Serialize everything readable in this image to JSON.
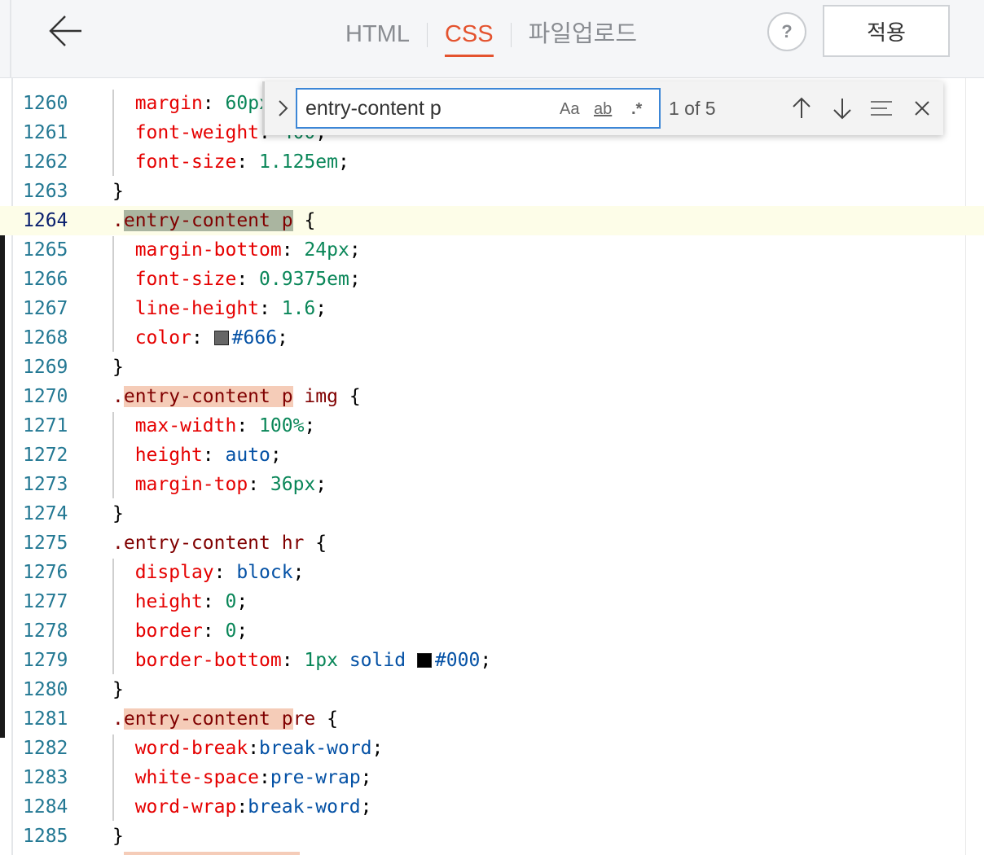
{
  "header": {
    "tabs": [
      {
        "label": "HTML",
        "active": false
      },
      {
        "label": "CSS",
        "active": true
      },
      {
        "label": "파일업로드",
        "active": false
      }
    ],
    "help_label": "?",
    "apply_label": "적용"
  },
  "find": {
    "query": "entry-content p",
    "match_case_label": "Aa",
    "whole_word_label": "ab",
    "regex_label": ".*",
    "match_count": "1 of 5"
  },
  "colors": {
    "accent": "#e4532f",
    "selector": "#800000",
    "property": "#e50000",
    "number": "#098658",
    "keyword": "#0451a5",
    "line_number": "#237893",
    "match_highlight": "#f5ccb8",
    "current_match": "#aab5a0",
    "current_line": "#fdfde8"
  },
  "code": {
    "current_line": 1264,
    "lines": [
      {
        "num": "1260",
        "text": "  margin: 60px 0 24px;"
      },
      {
        "num": "1261",
        "text": "  font-weight: 400;"
      },
      {
        "num": "1262",
        "text": "  font-size: 1.125em;"
      },
      {
        "num": "1263",
        "text": "}"
      },
      {
        "num": "1264",
        "text": ".entry-content p {"
      },
      {
        "num": "1265",
        "text": "  margin-bottom: 24px;"
      },
      {
        "num": "1266",
        "text": "  font-size: 0.9375em;"
      },
      {
        "num": "1267",
        "text": "  line-height: 1.6;"
      },
      {
        "num": "1268",
        "text": "  color: #666;"
      },
      {
        "num": "1269",
        "text": "}"
      },
      {
        "num": "1270",
        "text": ".entry-content p img {"
      },
      {
        "num": "1271",
        "text": "  max-width: 100%;"
      },
      {
        "num": "1272",
        "text": "  height: auto;"
      },
      {
        "num": "1273",
        "text": "  margin-top: 36px;"
      },
      {
        "num": "1274",
        "text": "}"
      },
      {
        "num": "1275",
        "text": ".entry-content hr {"
      },
      {
        "num": "1276",
        "text": "  display: block;"
      },
      {
        "num": "1277",
        "text": "  height: 0;"
      },
      {
        "num": "1278",
        "text": "  border: 0;"
      },
      {
        "num": "1279",
        "text": "  border-bottom: 1px solid #000;"
      },
      {
        "num": "1280",
        "text": "}"
      },
      {
        "num": "1281",
        "text": ".entry-content pre {"
      },
      {
        "num": "1282",
        "text": "  word-break:break-word;"
      },
      {
        "num": "1283",
        "text": "  white-space:pre-wrap;"
      },
      {
        "num": "1284",
        "text": "  word-wrap:break-word;"
      },
      {
        "num": "1285",
        "text": "}"
      }
    ]
  }
}
